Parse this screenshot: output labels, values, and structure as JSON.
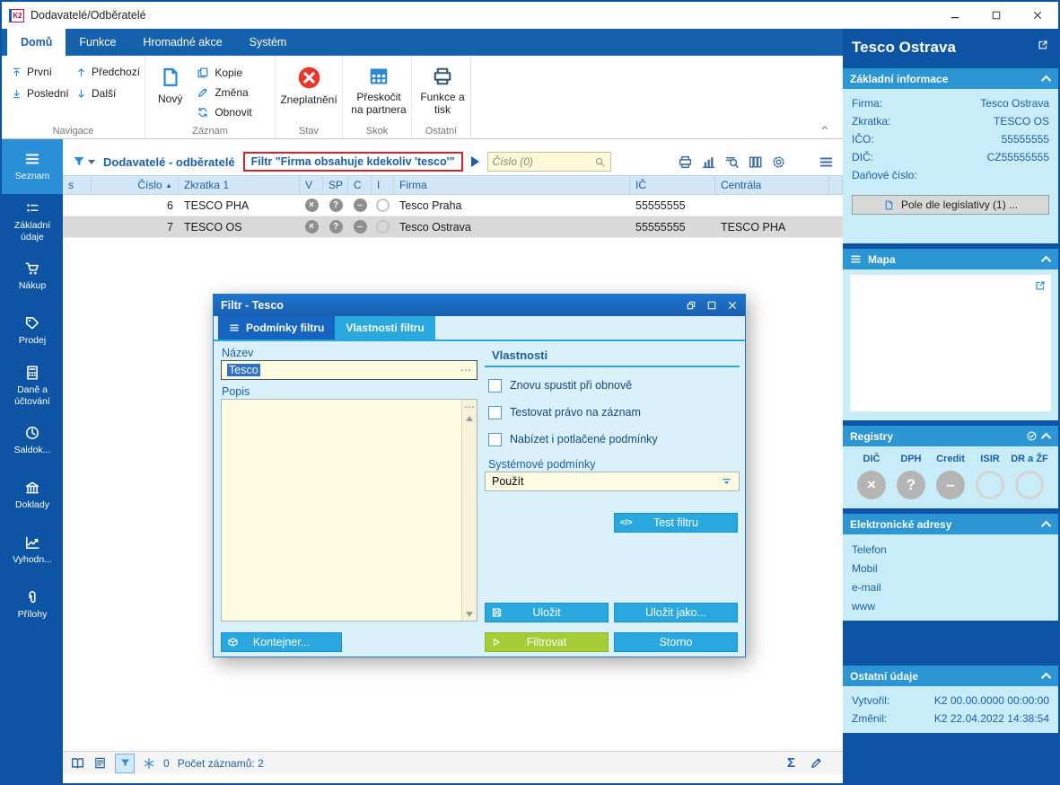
{
  "window": {
    "title": "Dodavatelé/Odběratelé",
    "app_badge": "K2"
  },
  "glyphs": {
    "sort_asc": "▲",
    "dots": "⋯",
    "code_icon": "</>",
    "circle_x": "×",
    "circle_q": "?",
    "circle_dash": "–",
    "sigma": "Σ"
  },
  "ribbon": {
    "tabs": [
      {
        "label": "Domů"
      },
      {
        "label": "Funkce"
      },
      {
        "label": "Hromadné akce"
      },
      {
        "label": "Systém"
      }
    ],
    "navigace": {
      "label": "Navigace",
      "prvni": "První",
      "predchozi": "Předchozí",
      "posledni": "Poslední",
      "dalsi": "Další"
    },
    "zaznam": {
      "label": "Záznam",
      "novy": "Nový",
      "kopie": "Kopie",
      "zmena": "Změna",
      "obnovit": "Obnovit"
    },
    "stav": {
      "label": "Stav",
      "zneplatneni": "Zneplatnění"
    },
    "skok": {
      "label": "Skok",
      "preskocit": "Přeskočit na partnera"
    },
    "ostatni": {
      "label": "Ostatní",
      "funkce_a_tisk": "Funkce a tisk"
    }
  },
  "sidebar": {
    "items": [
      {
        "label": "Seznam"
      },
      {
        "label": "Základní údaje"
      },
      {
        "label": "Nákup"
      },
      {
        "label": "Prodej"
      },
      {
        "label": "Daně a účtování"
      },
      {
        "label": "Saldok..."
      },
      {
        "label": "Doklady"
      },
      {
        "label": "Vyhodn..."
      },
      {
        "label": "Přílohy"
      }
    ]
  },
  "browse": {
    "title": "Dodavatelé - odběratelé",
    "filter_badge": "Filtr \"Firma obsahuje kdekoliv 'tesco'\"",
    "search_placeholder": "Číslo (0)",
    "columns": [
      "s",
      "Číslo",
      "Zkratka 1",
      "V",
      "SP",
      "C",
      "I",
      "Firma",
      "IČ",
      "Centrála"
    ],
    "rows": [
      {
        "cislo": "6",
        "zkratka": "TESCO PHA",
        "firma": "Tesco Praha",
        "ic": "55555555",
        "centrala": ""
      },
      {
        "cislo": "7",
        "zkratka": "TESCO OS",
        "firma": "Tesco Ostrava",
        "ic": "55555555",
        "centrala": "TESCO PHA"
      }
    ],
    "status": {
      "frozen_count": "0",
      "record_count": "Počet záznamů: 2"
    }
  },
  "dialog": {
    "title": "Filtr - Tesco",
    "tabs": [
      {
        "label": "Podmínky filtru"
      },
      {
        "label": "Vlastnosti filtru"
      }
    ],
    "nazev": {
      "label": "Název",
      "value": "Tesco"
    },
    "popis": {
      "label": "Popis",
      "value": ""
    },
    "vlastnosti_heading": "Vlastnosti",
    "checkboxes": [
      {
        "label": "Znovu spustit při obnově",
        "checked": false
      },
      {
        "label": "Testovat právo na záznam",
        "checked": false
      },
      {
        "label": "Nabízet i potlačené podmínky",
        "checked": false
      }
    ],
    "systemove": {
      "label": "Systémové podmínky",
      "value": "Použít"
    },
    "buttons": {
      "test": "Test filtru",
      "ulozit": "Uložit",
      "ulozit_jako": "Uložit jako...",
      "kontejner": "Kontejner...",
      "filtrovat": "Filtrovat",
      "storno": "Storno"
    }
  },
  "panel": {
    "title": "Tesco Ostrava",
    "zakladni": {
      "header": "Základní informace",
      "fields": [
        {
          "label": "Firma:",
          "value": "Tesco Ostrava"
        },
        {
          "label": "Zkratka:",
          "value": "TESCO OS"
        },
        {
          "label": "IČO:",
          "value": "55555555"
        },
        {
          "label": "DIČ:",
          "value": "CZ55555555"
        },
        {
          "label": "Daňové číslo:",
          "value": ""
        }
      ],
      "legislativa": "Pole dle legislativy (1) ..."
    },
    "mapa": {
      "header": "Mapa"
    },
    "registry": {
      "header": "Registry",
      "items": [
        {
          "label": "DIČ",
          "state": "x"
        },
        {
          "label": "DPH",
          "state": "question"
        },
        {
          "label": "Credit",
          "state": "dash"
        },
        {
          "label": "ISIR",
          "state": "empty"
        },
        {
          "label": "DR a ŽF",
          "state": "empty"
        }
      ]
    },
    "adresy": {
      "header": "Elektronické adresy",
      "links": [
        {
          "label": "Telefon"
        },
        {
          "label": "Mobil"
        },
        {
          "label": "e-mail"
        },
        {
          "label": "www"
        }
      ]
    },
    "ostatni": {
      "header": "Ostatní údaje",
      "fields": [
        {
          "label": "Vytvořil:",
          "value": "K2 00.00.0000 00:00:00"
        },
        {
          "label": "Změnil:",
          "value": "K2 22.04.2022 14:38:54"
        }
      ]
    }
  }
}
